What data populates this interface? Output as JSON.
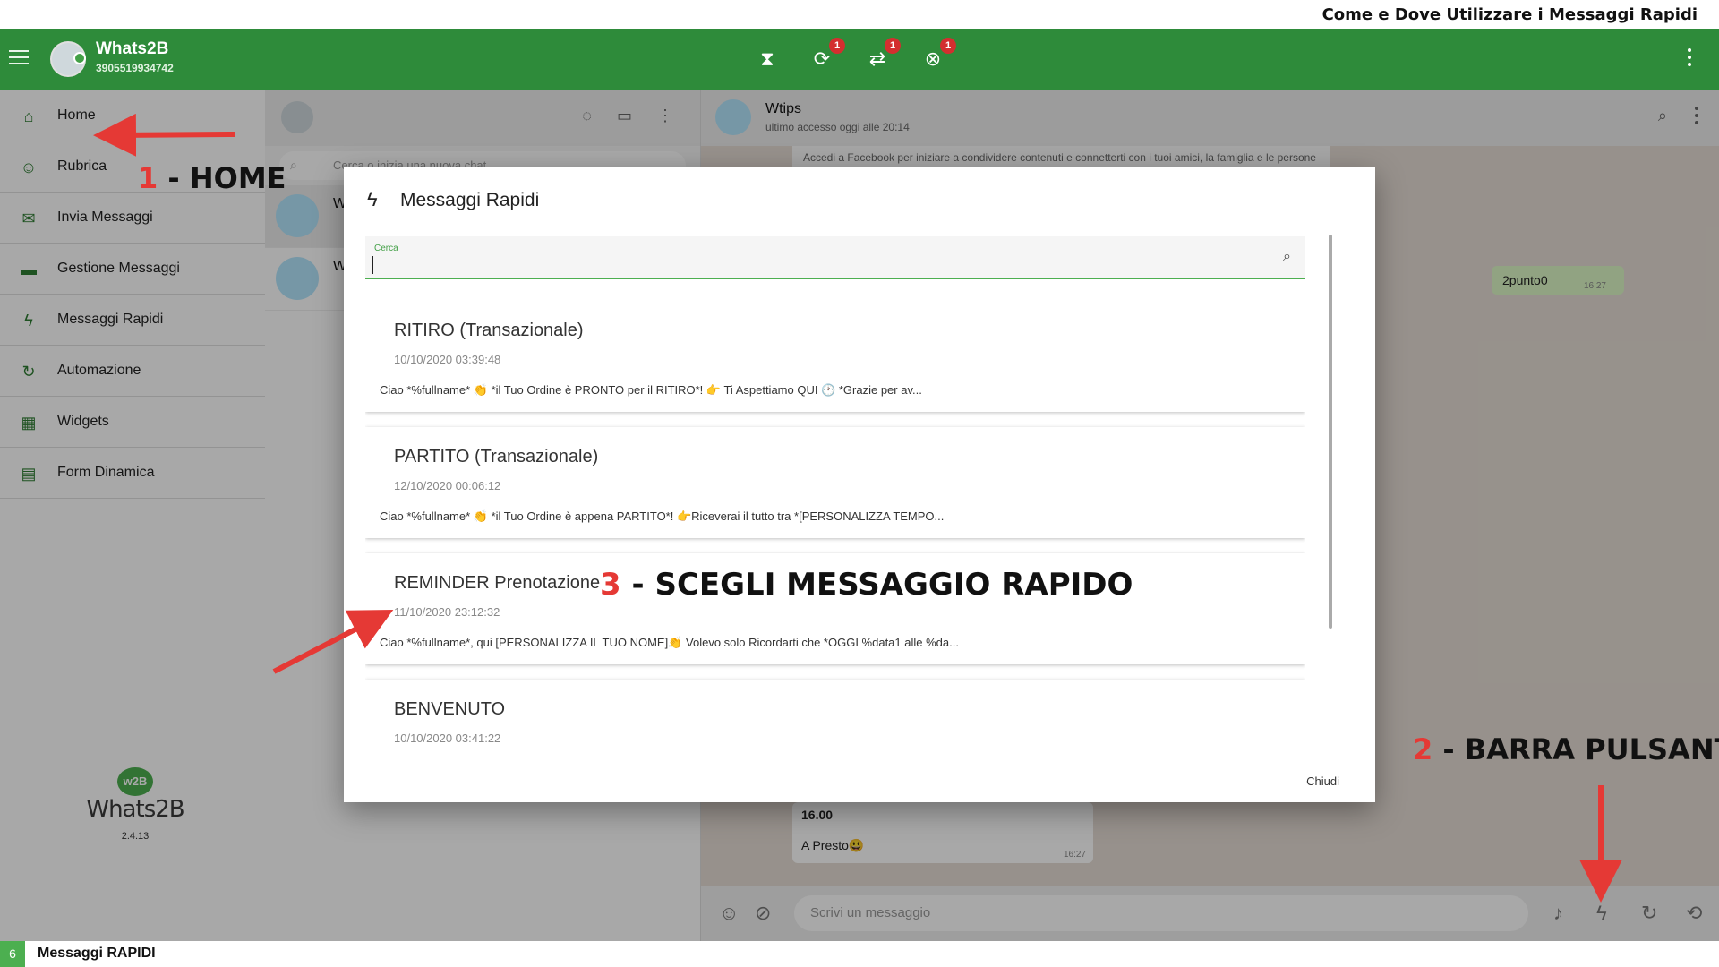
{
  "caption": "Come e Dove Utilizzare i Messaggi Rapidi",
  "header": {
    "app_name": "Whats2B",
    "phone": "3905519934742",
    "badges": [
      "1",
      "1",
      "1"
    ]
  },
  "sidebar": {
    "items": [
      {
        "label": "Home",
        "icon": "home-icon"
      },
      {
        "label": "Rubrica",
        "icon": "contacts-icon"
      },
      {
        "label": "Invia Messaggi",
        "icon": "mail-icon"
      },
      {
        "label": "Gestione Messaggi",
        "icon": "folder-icon"
      },
      {
        "label": "Messaggi Rapidi",
        "icon": "lightning-icon"
      },
      {
        "label": "Automazione",
        "icon": "refresh-icon"
      },
      {
        "label": "Widgets",
        "icon": "widgets-icon"
      },
      {
        "label": "Form Dinamica",
        "icon": "form-icon"
      }
    ],
    "logo_text": "Whats2B",
    "logo_badge": "w2B",
    "version": "2.4.13"
  },
  "chatlist": {
    "search_placeholder": "Cerca o inizia una nuova chat",
    "rows": [
      {
        "initial": "W"
      },
      {
        "initial": "W"
      }
    ]
  },
  "chat": {
    "contact_name": "Wtips",
    "status": "ultimo accesso oggi alle 20:14",
    "fb_notice": "Accedi a Facebook per iniziare a condividere contenuti e connetterti con i tuoi amici, la famiglia e le persone",
    "out_message": "2punto0",
    "out_time": "16:27",
    "in_bold": "16.00",
    "in_message": "A Presto😃",
    "in_time": "16:27",
    "composer_placeholder": "Scrivi un messaggio"
  },
  "modal": {
    "title": "Messaggi Rapidi",
    "search_label": "Cerca",
    "close_label": "Chiudi",
    "cards": [
      {
        "title": "RITIRO (Transazionale)",
        "date": "10/10/2020 03:39:48",
        "preview": "Ciao *%fullname* 👏 *il Tuo Ordine è PRONTO per il RITIRO*! 👉 Ti Aspettiamo QUI 🕐 *Grazie per av..."
      },
      {
        "title": "PARTITO (Transazionale)",
        "date": "12/10/2020 00:06:12",
        "preview": "Ciao *%fullname* 👏 *il Tuo Ordine è appena PARTITO*! 👉Riceverai il tutto tra *[PERSONALIZZA TEMPO..."
      },
      {
        "title": "REMINDER Prenotazione",
        "date": "11/10/2020 23:12:32",
        "preview": "Ciao *%fullname*, qui [PERSONALIZZA IL TUO NOME]👏 Volevo solo Ricordarti che *OGGI %data1 alle %da..."
      },
      {
        "title": "BENVENUTO",
        "date": "10/10/2020 03:41:22",
        "preview": ""
      }
    ]
  },
  "annotations": {
    "a1_num": "1",
    "a1_text": " - HOME",
    "a2_num": "2",
    "a2_text": " - BARRA PULSANTI",
    "a3_num": "3",
    "a3_text": " - SCEGLI MESSAGGIO RAPIDO",
    "color": "#e53935"
  },
  "footer": {
    "page_number": "6",
    "title": "Messaggi RAPIDI"
  },
  "colors": {
    "brand_green": "#2e8b3a",
    "accent_green": "#4caf50",
    "badge_red": "#d32f2f"
  }
}
